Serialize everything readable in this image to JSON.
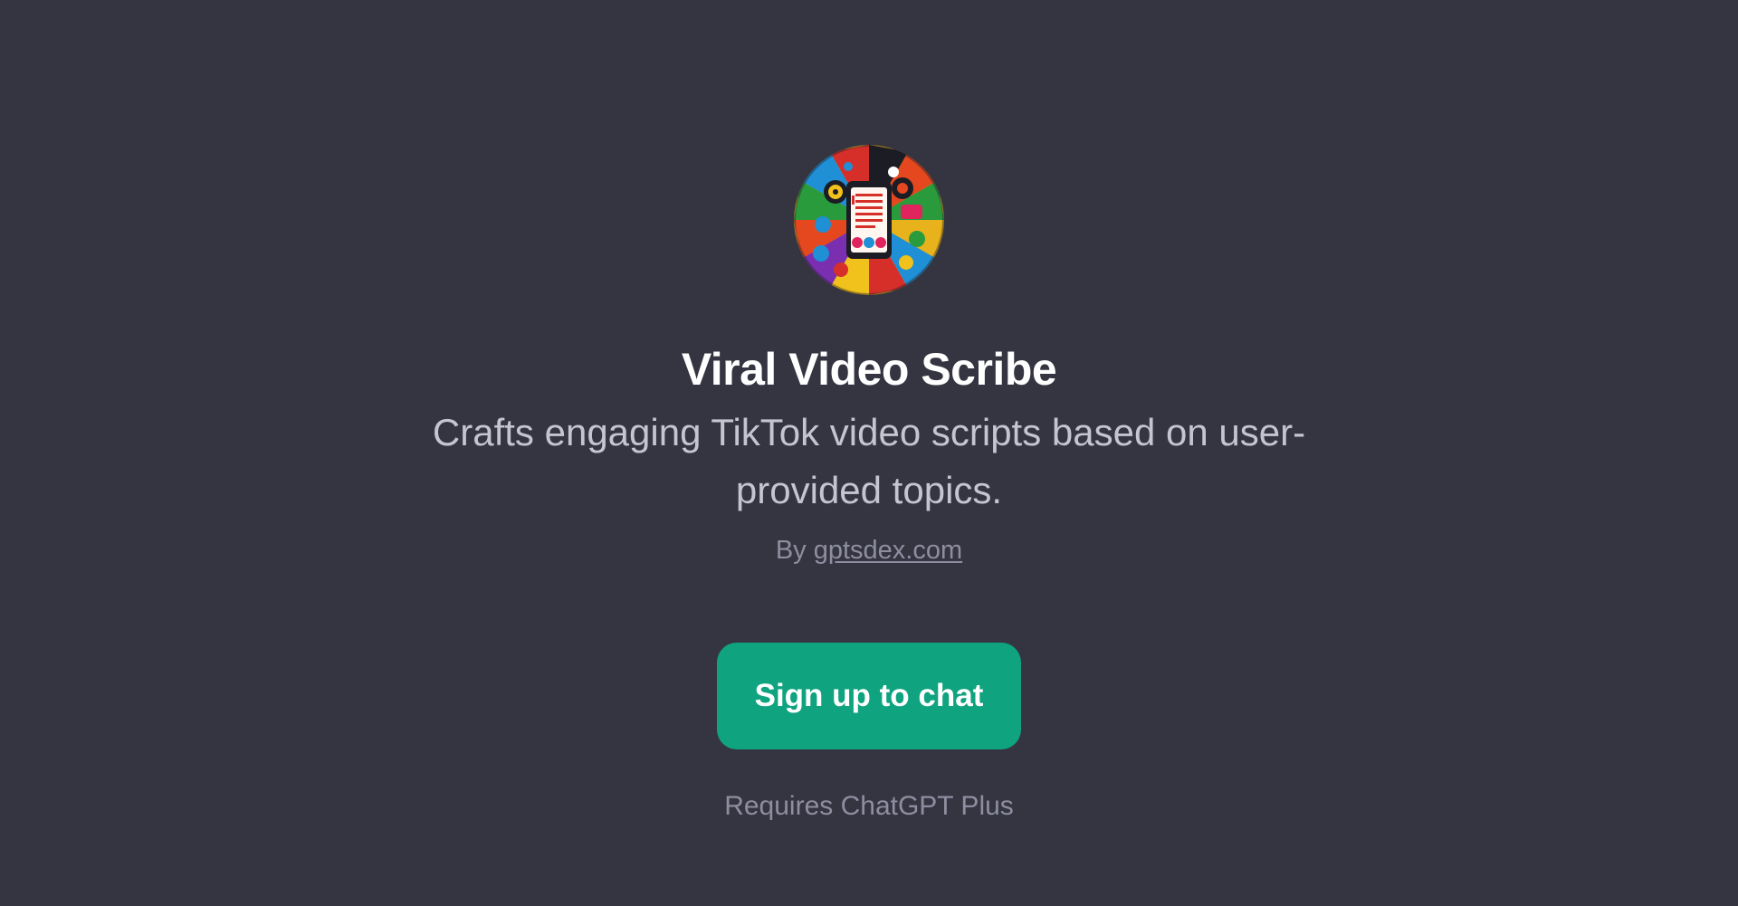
{
  "gpt": {
    "avatar_icon": "colorful-social-media-collage-phone-script-icon",
    "title": "Viral Video Scribe",
    "description": "Crafts engaging TikTok video scripts based on user-provided topics.",
    "by_prefix": "By",
    "author": "gptsdex.com"
  },
  "cta": {
    "signup_label": "Sign up to chat",
    "requirement": "Requires ChatGPT Plus"
  },
  "colors": {
    "background": "#343541",
    "accent": "#10a37f",
    "title": "#ffffff",
    "description": "#c5c5d2",
    "muted": "#8e8ea0"
  }
}
